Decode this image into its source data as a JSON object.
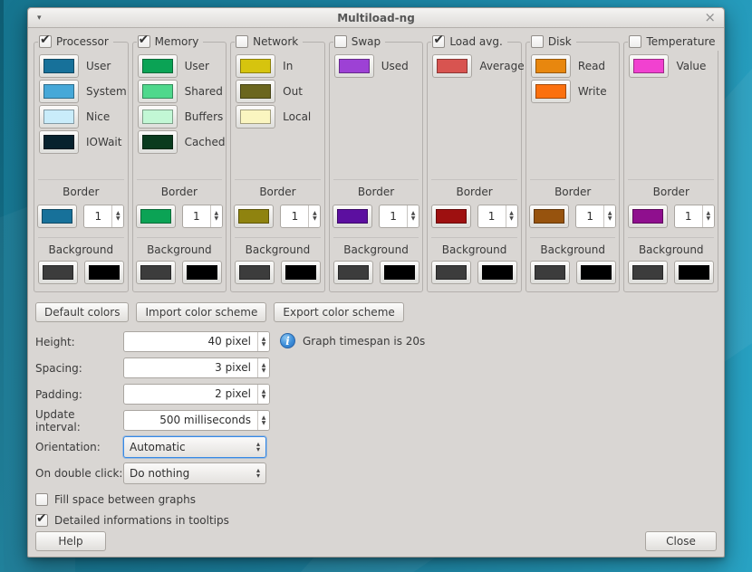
{
  "window": {
    "title": "Multiload-ng",
    "menu_icon": "▾",
    "close_icon": "×"
  },
  "labels": {
    "border": "Border",
    "background": "Background"
  },
  "graphs": [
    {
      "label": "Processor",
      "checked": true,
      "colors": [
        {
          "name": "User",
          "hex": "#17719a"
        },
        {
          "name": "System",
          "hex": "#46a8d8"
        },
        {
          "name": "Nice",
          "hex": "#c9ecfa"
        },
        {
          "name": "IOWait",
          "hex": "#07222e"
        }
      ],
      "border": {
        "hex": "#17719a",
        "width": "1"
      },
      "background": [
        "#3c3c3c",
        "#000000"
      ]
    },
    {
      "label": "Memory",
      "checked": true,
      "colors": [
        {
          "name": "User",
          "hex": "#0ba355"
        },
        {
          "name": "Shared",
          "hex": "#4fd88c"
        },
        {
          "name": "Buffers",
          "hex": "#c2f7d5"
        },
        {
          "name": "Cached",
          "hex": "#0a3b1e"
        }
      ],
      "border": {
        "hex": "#0ba355",
        "width": "1"
      },
      "background": [
        "#3c3c3c",
        "#000000"
      ]
    },
    {
      "label": "Network",
      "checked": false,
      "colors": [
        {
          "name": "In",
          "hex": "#d6c40e"
        },
        {
          "name": "Out",
          "hex": "#6b661e"
        },
        {
          "name": "Local",
          "hex": "#faf5c0"
        }
      ],
      "border": {
        "hex": "#8f830f",
        "width": "1"
      },
      "background": [
        "#3c3c3c",
        "#000000"
      ]
    },
    {
      "label": "Swap",
      "checked": false,
      "colors": [
        {
          "name": "Used",
          "hex": "#9d41d5"
        }
      ],
      "border": {
        "hex": "#5c0fa0",
        "width": "1"
      },
      "background": [
        "#3c3c3c",
        "#000000"
      ]
    },
    {
      "label": "Load avg.",
      "checked": true,
      "colors": [
        {
          "name": "Average",
          "hex": "#d85450"
        }
      ],
      "border": {
        "hex": "#9e1010",
        "width": "1"
      },
      "background": [
        "#3c3c3c",
        "#000000"
      ]
    },
    {
      "label": "Disk",
      "checked": false,
      "colors": [
        {
          "name": "Read",
          "hex": "#e8870e"
        },
        {
          "name": "Write",
          "hex": "#fb700e"
        }
      ],
      "border": {
        "hex": "#97530e",
        "width": "1"
      },
      "background": [
        "#3c3c3c",
        "#000000"
      ]
    },
    {
      "label": "Temperature",
      "checked": false,
      "colors": [
        {
          "name": "Value",
          "hex": "#f141d0"
        }
      ],
      "border": {
        "hex": "#8f0f8e",
        "width": "1"
      },
      "background": [
        "#3c3c3c",
        "#000000"
      ]
    }
  ],
  "actions": [
    "Default colors",
    "Import color scheme",
    "Export color scheme"
  ],
  "settings": {
    "rows": [
      {
        "label": "Height:",
        "value": "40 pixel",
        "type": "spin"
      },
      {
        "label": "Spacing:",
        "value": "3 pixel",
        "type": "spin"
      },
      {
        "label": "Padding:",
        "value": "2 pixel",
        "type": "spin"
      },
      {
        "label": "Update interval:",
        "value": "500 milliseconds",
        "type": "spin"
      },
      {
        "label": "Orientation:",
        "value": "Automatic",
        "type": "combo",
        "focused": true
      },
      {
        "label": "On double click:",
        "value": "Do nothing",
        "type": "combo",
        "focused": false
      }
    ],
    "info_text": "Graph timespan is 20s"
  },
  "checkboxes": [
    {
      "label": "Fill space between graphs",
      "checked": false
    },
    {
      "label": "Detailed informations in tooltips",
      "checked": true
    }
  ],
  "footer": {
    "help": "Help",
    "close": "Close"
  }
}
